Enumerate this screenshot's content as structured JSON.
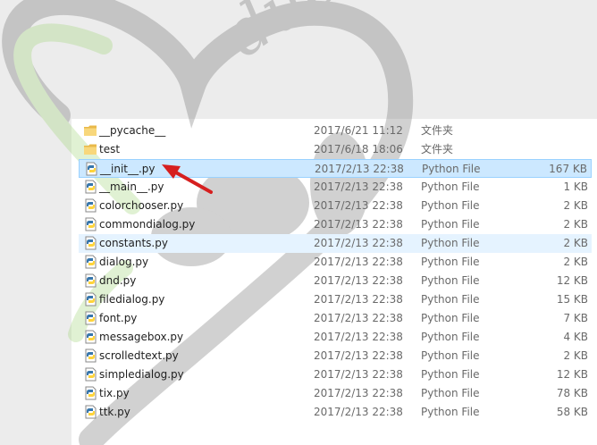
{
  "colors": {
    "window_bg": "#ececec",
    "content_bg": "#ffffff",
    "selected_row": "#cce8ff",
    "selected_border": "#99d1ff",
    "hover_row": "#e5f3ff",
    "annotation_arrow": "#d61f1f",
    "watermark_text": "#7a7a7a",
    "watermark_green": "#a6d77f"
  },
  "watermark": {
    "text": "duohao"
  },
  "files": [
    {
      "name": "__pycache__",
      "date": "2017/6/21 11:12",
      "type": "文件夹",
      "size": "",
      "icon": "folder-icon"
    },
    {
      "name": "test",
      "date": "2017/6/18 18:06",
      "type": "文件夹",
      "size": "",
      "icon": "folder-icon"
    },
    {
      "name": "__init__.py",
      "date": "2017/2/13 22:38",
      "type": "Python File",
      "size": "167 KB",
      "icon": "python-file-icon"
    },
    {
      "name": "__main__.py",
      "date": "2017/2/13 22:38",
      "type": "Python File",
      "size": "1 KB",
      "icon": "python-file-icon"
    },
    {
      "name": "colorchooser.py",
      "date": "2017/2/13 22:38",
      "type": "Python File",
      "size": "2 KB",
      "icon": "python-file-icon"
    },
    {
      "name": "commondialog.py",
      "date": "2017/2/13 22:38",
      "type": "Python File",
      "size": "2 KB",
      "icon": "python-file-icon"
    },
    {
      "name": "constants.py",
      "date": "2017/2/13 22:38",
      "type": "Python File",
      "size": "2 KB",
      "icon": "python-file-icon"
    },
    {
      "name": "dialog.py",
      "date": "2017/2/13 22:38",
      "type": "Python File",
      "size": "2 KB",
      "icon": "python-file-icon"
    },
    {
      "name": "dnd.py",
      "date": "2017/2/13 22:38",
      "type": "Python File",
      "size": "12 KB",
      "icon": "python-file-icon"
    },
    {
      "name": "filedialog.py",
      "date": "2017/2/13 22:38",
      "type": "Python File",
      "size": "15 KB",
      "icon": "python-file-icon"
    },
    {
      "name": "font.py",
      "date": "2017/2/13 22:38",
      "type": "Python File",
      "size": "7 KB",
      "icon": "python-file-icon"
    },
    {
      "name": "messagebox.py",
      "date": "2017/2/13 22:38",
      "type": "Python File",
      "size": "4 KB",
      "icon": "python-file-icon"
    },
    {
      "name": "scrolledtext.py",
      "date": "2017/2/13 22:38",
      "type": "Python File",
      "size": "2 KB",
      "icon": "python-file-icon"
    },
    {
      "name": "simpledialog.py",
      "date": "2017/2/13 22:38",
      "type": "Python File",
      "size": "12 KB",
      "icon": "python-file-icon"
    },
    {
      "name": "tix.py",
      "date": "2017/2/13 22:38",
      "type": "Python File",
      "size": "78 KB",
      "icon": "python-file-icon"
    },
    {
      "name": "ttk.py",
      "date": "2017/2/13 22:38",
      "type": "Python File",
      "size": "58 KB",
      "icon": "python-file-icon"
    }
  ]
}
